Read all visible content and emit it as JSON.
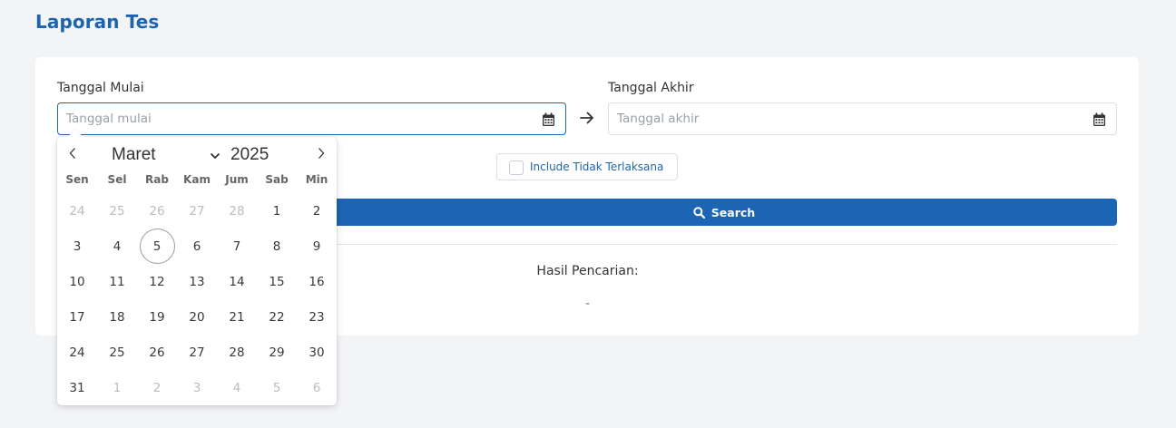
{
  "page": {
    "title": "Laporan Tes"
  },
  "form": {
    "start_label": "Tanggal Mulai",
    "start_placeholder": "Tanggal mulai",
    "end_label": "Tanggal Akhir",
    "end_placeholder": "Tanggal akhir",
    "include_label": "Include Tidak Terlaksana",
    "include_checked": false,
    "search_label": "Search"
  },
  "results": {
    "title": "Hasil Pencarian:",
    "value": "-"
  },
  "calendar": {
    "month": "Maret",
    "year": "2025",
    "weekdays": [
      "Sen",
      "Sel",
      "Rab",
      "Kam",
      "Jum",
      "Sab",
      "Min"
    ],
    "weeks": [
      [
        {
          "d": "24",
          "m": true
        },
        {
          "d": "25",
          "m": true
        },
        {
          "d": "26",
          "m": true
        },
        {
          "d": "27",
          "m": true
        },
        {
          "d": "28",
          "m": true
        },
        {
          "d": "1"
        },
        {
          "d": "2"
        }
      ],
      [
        {
          "d": "3"
        },
        {
          "d": "4"
        },
        {
          "d": "5",
          "today": true
        },
        {
          "d": "6"
        },
        {
          "d": "7"
        },
        {
          "d": "8"
        },
        {
          "d": "9"
        }
      ],
      [
        {
          "d": "10"
        },
        {
          "d": "11"
        },
        {
          "d": "12"
        },
        {
          "d": "13"
        },
        {
          "d": "14"
        },
        {
          "d": "15"
        },
        {
          "d": "16"
        }
      ],
      [
        {
          "d": "17"
        },
        {
          "d": "18"
        },
        {
          "d": "19"
        },
        {
          "d": "20"
        },
        {
          "d": "21"
        },
        {
          "d": "22"
        },
        {
          "d": "23"
        }
      ],
      [
        {
          "d": "24"
        },
        {
          "d": "25"
        },
        {
          "d": "26"
        },
        {
          "d": "27"
        },
        {
          "d": "28"
        },
        {
          "d": "29"
        },
        {
          "d": "30"
        }
      ],
      [
        {
          "d": "31"
        },
        {
          "d": "1",
          "m": true
        },
        {
          "d": "2",
          "m": true
        },
        {
          "d": "3",
          "m": true
        },
        {
          "d": "4",
          "m": true
        },
        {
          "d": "5",
          "m": true
        },
        {
          "d": "6",
          "m": true
        }
      ]
    ]
  },
  "colors": {
    "accent": "#1e63ad",
    "button": "#1c64b4",
    "background": "#f3f4f6"
  },
  "icons": {
    "start_calendar": "calendar-icon",
    "end_calendar": "calendar-icon",
    "range_arrow": "arrow-right-icon",
    "search": "search-icon",
    "prev": "chevron-left-icon",
    "next": "chevron-right-icon",
    "month_dropdown": "chevron-down-icon"
  }
}
